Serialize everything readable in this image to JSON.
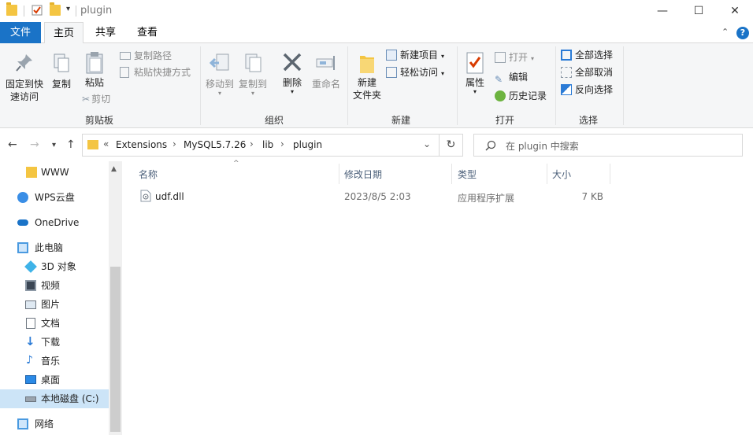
{
  "window": {
    "title": "plugin"
  },
  "tabs": {
    "file": "文件",
    "home": "主页",
    "share": "共享",
    "view": "查看"
  },
  "ribbon": {
    "clipboard": {
      "label": "剪贴板",
      "pin": "固定到快速访问",
      "pin_l1": "固定到快",
      "pin_l2": "速访问",
      "copy": "复制",
      "paste": "粘贴",
      "copy_path": "复制路径",
      "paste_shortcut": "粘贴快捷方式",
      "cut": "剪切"
    },
    "organize": {
      "label": "组织",
      "move_to": "移动到",
      "copy_to": "复制到",
      "delete": "删除",
      "rename": "重命名"
    },
    "new": {
      "label": "新建",
      "new_folder_l1": "新建",
      "new_folder_l2": "文件夹",
      "new_item": "新建项目",
      "easy_access": "轻松访问"
    },
    "open": {
      "label": "打开",
      "properties": "属性",
      "open": "打开",
      "edit": "编辑",
      "history": "历史记录"
    },
    "select": {
      "label": "选择",
      "select_all": "全部选择",
      "select_none": "全部取消",
      "invert": "反向选择"
    }
  },
  "address": {
    "overflow": "«",
    "crumbs": [
      "Extensions",
      "MySQL5.7.26",
      "lib",
      "plugin"
    ],
    "search_placeholder": "在 plugin 中搜索"
  },
  "nav": {
    "items": [
      {
        "label": "WWW",
        "icon": "folder-icon"
      },
      {
        "label": "WPS云盘",
        "icon": "cloud-icon"
      },
      {
        "label": "OneDrive",
        "icon": "onedrive-icon"
      },
      {
        "label": "此电脑",
        "icon": "computer-icon"
      },
      {
        "label": "3D 对象",
        "icon": "3d-objects-icon"
      },
      {
        "label": "视频",
        "icon": "video-icon"
      },
      {
        "label": "图片",
        "icon": "pictures-icon"
      },
      {
        "label": "文档",
        "icon": "documents-icon"
      },
      {
        "label": "下载",
        "icon": "download-icon"
      },
      {
        "label": "音乐",
        "icon": "music-icon"
      },
      {
        "label": "桌面",
        "icon": "desktop-icon"
      },
      {
        "label": "本地磁盘 (C:)",
        "icon": "drive-icon"
      },
      {
        "label": "网络",
        "icon": "network-icon"
      }
    ]
  },
  "files": {
    "columns": {
      "name": "名称",
      "modified": "修改日期",
      "type": "类型",
      "size": "大小"
    },
    "rows": [
      {
        "name": "udf.dll",
        "modified": "2023/8/5 2:03",
        "type": "应用程序扩展",
        "size": "7 KB"
      }
    ]
  }
}
